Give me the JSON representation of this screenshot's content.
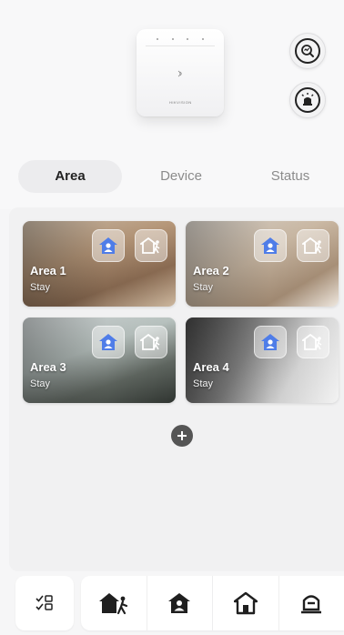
{
  "tabs": [
    {
      "label": "Area",
      "active": true
    },
    {
      "label": "Device",
      "active": false
    },
    {
      "label": "Status",
      "active": false
    }
  ],
  "header": {
    "device_brand": "HIKVISION",
    "right_buttons": [
      {
        "icon": "zoom-check-icon"
      },
      {
        "icon": "siren-icon"
      }
    ]
  },
  "areas": [
    {
      "name": "Area 1",
      "status": "Stay",
      "icons": [
        "stay-home-icon",
        "away-exit-icon"
      ]
    },
    {
      "name": "Area 2",
      "status": "Stay",
      "icons": [
        "stay-home-icon",
        "away-exit-icon"
      ]
    },
    {
      "name": "Area 3",
      "status": "Stay",
      "icons": [
        "stay-home-icon",
        "away-exit-icon"
      ]
    },
    {
      "name": "Area 4",
      "status": "Stay",
      "icons": [
        "stay-home-icon",
        "away-exit-icon"
      ]
    }
  ],
  "bottom_bar": {
    "left_icon": "multi-select-icon",
    "icons": [
      "away-arm-icon",
      "stay-arm-icon",
      "disarm-icon",
      "clear-alarm-icon"
    ]
  },
  "colors": {
    "accent_blue": "#4f7de8",
    "dark_icon": "#1f1f1f",
    "tab_active_bg": "#ececee"
  }
}
